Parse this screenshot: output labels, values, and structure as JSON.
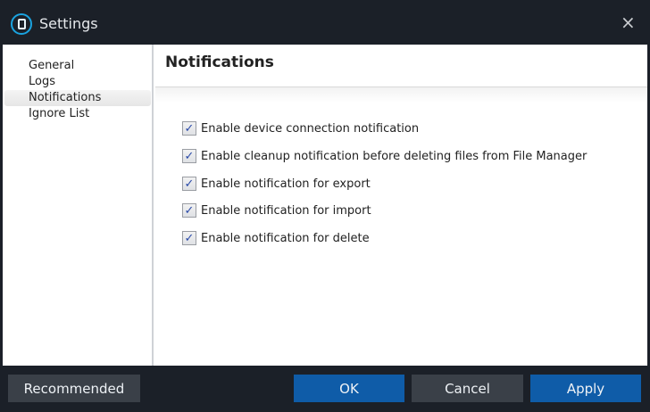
{
  "window": {
    "title": "Settings",
    "close_icon": "×"
  },
  "sidebar": {
    "items": [
      {
        "label": "General"
      },
      {
        "label": "Logs"
      },
      {
        "label": "Notifications"
      },
      {
        "label": "Ignore List"
      }
    ]
  },
  "main": {
    "title": "Notifications",
    "options": [
      {
        "label": "Enable device connection notification",
        "checked": true
      },
      {
        "label": "Enable cleanup notification before deleting files from File Manager",
        "checked": true
      },
      {
        "label": "Enable notification for export",
        "checked": true
      },
      {
        "label": "Enable notification for import",
        "checked": true
      },
      {
        "label": "Enable notification for delete",
        "checked": true
      }
    ]
  },
  "footer": {
    "recommended": "Recommended",
    "ok": "OK",
    "cancel": "Cancel",
    "apply": "Apply"
  },
  "check_glyph": "✓"
}
